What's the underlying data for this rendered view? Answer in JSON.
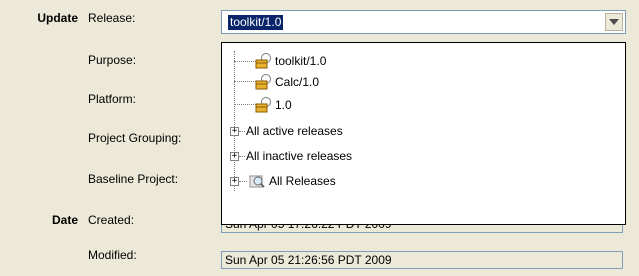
{
  "sections": {
    "update_label": "Update",
    "date_label": "Date"
  },
  "labels": {
    "release": "Release:",
    "purpose": "Purpose:",
    "platform": "Platform:",
    "project_grouping": "Project Grouping:",
    "baseline_project": "Baseline Project:",
    "created": "Created:",
    "modified": "Modified:"
  },
  "release_combo": {
    "selected_value": "toolkit/1.0"
  },
  "dropdown_tree": {
    "items": [
      {
        "label": "toolkit/1.0",
        "icon": "package-icon"
      },
      {
        "label": "Calc/1.0",
        "icon": "package-icon"
      },
      {
        "label": "1.0",
        "icon": "package-icon"
      },
      {
        "label": "All active releases",
        "expander": "+"
      },
      {
        "label": "All inactive releases",
        "expander": "+"
      },
      {
        "label": "All Releases",
        "expander": "+",
        "icon": "search-icon"
      }
    ]
  },
  "fields": {
    "created_value": "Sun Apr 05 17:26:22 PDT 2009",
    "modified_value": "Sun Apr 05 21:26:56 PDT 2009"
  },
  "colors": {
    "window_bg": "#ece9d8",
    "selection_bg": "#0a246a",
    "field_border": "#7f9db9"
  }
}
